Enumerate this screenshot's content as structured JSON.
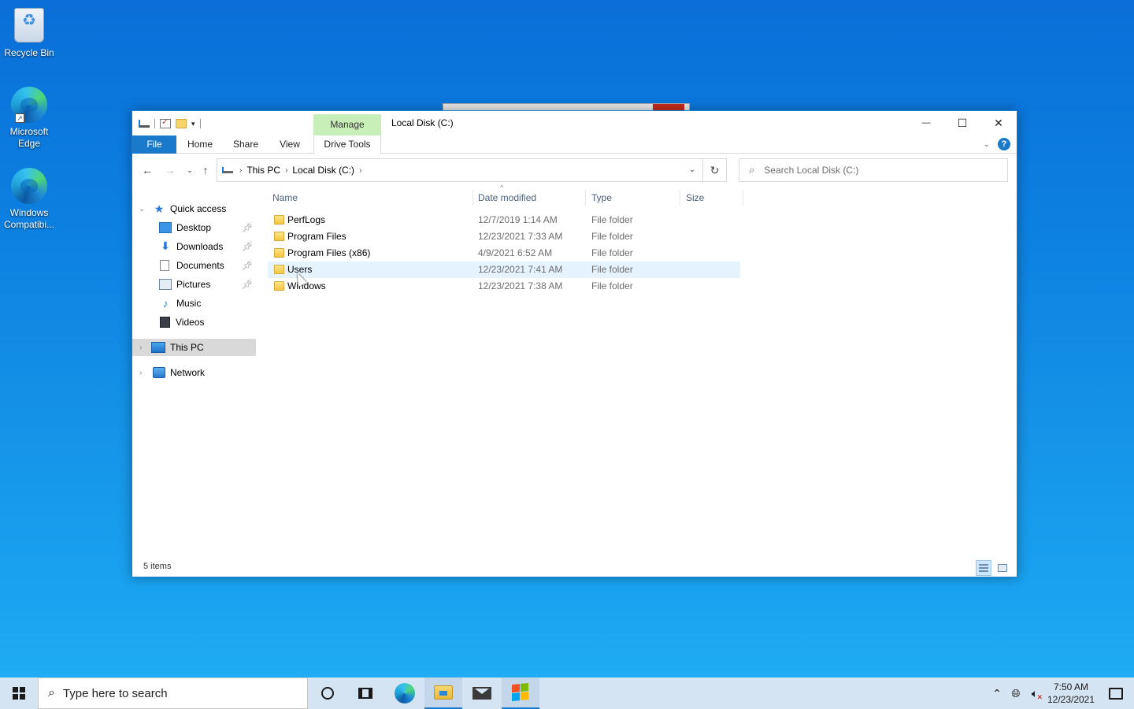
{
  "desktop": {
    "icons": [
      {
        "label": "Recycle Bin"
      },
      {
        "label": "Microsoft Edge"
      },
      {
        "label": "Windows Compatibi..."
      }
    ]
  },
  "window": {
    "title": "Local Disk (C:)",
    "context_tab_group": "Manage",
    "ribbon_tabs": {
      "file": "File",
      "home": "Home",
      "share": "Share",
      "view": "View",
      "drive_tools": "Drive Tools"
    },
    "controls": {
      "minimize": "—",
      "maximize": "☐",
      "close": "✕"
    }
  },
  "address_bar": {
    "breadcrumbs": [
      "This PC",
      "Local Disk (C:)"
    ]
  },
  "search": {
    "placeholder": "Search Local Disk (C:)"
  },
  "nav_pane": {
    "quick_access": "Quick access",
    "items": [
      {
        "label": "Desktop",
        "icon": "desktop-icon",
        "pinned": true
      },
      {
        "label": "Downloads",
        "icon": "downloads-icon",
        "pinned": true
      },
      {
        "label": "Documents",
        "icon": "documents-icon",
        "pinned": true
      },
      {
        "label": "Pictures",
        "icon": "pictures-icon",
        "pinned": true
      },
      {
        "label": "Music",
        "icon": "music-icon",
        "pinned": false
      },
      {
        "label": "Videos",
        "icon": "videos-icon",
        "pinned": false
      }
    ],
    "this_pc": "This PC",
    "network": "Network"
  },
  "file_list": {
    "columns": {
      "name": "Name",
      "date": "Date modified",
      "type": "Type",
      "size": "Size"
    },
    "rows": [
      {
        "name": "PerfLogs",
        "date": "12/7/2019 1:14 AM",
        "type": "File folder"
      },
      {
        "name": "Program Files",
        "date": "12/23/2021 7:33 AM",
        "type": "File folder"
      },
      {
        "name": "Program Files (x86)",
        "date": "4/9/2021 6:52 AM",
        "type": "File folder"
      },
      {
        "name": "Users",
        "date": "12/23/2021 7:41 AM",
        "type": "File folder"
      },
      {
        "name": "Windows",
        "date": "12/23/2021 7:38 AM",
        "type": "File folder"
      }
    ]
  },
  "status_bar": {
    "item_count": "5 items"
  },
  "taskbar": {
    "search_placeholder": "Type here to search",
    "clock_time": "7:50 AM",
    "clock_date": "12/23/2021"
  },
  "colors": {
    "accent": "#1979ca",
    "manage_tab": "#c7efb7",
    "hover_row": "#e5f3ff"
  }
}
